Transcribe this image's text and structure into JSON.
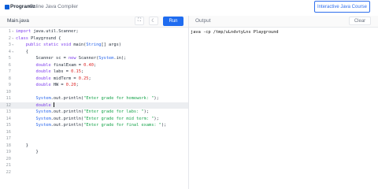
{
  "header": {
    "logo_text": "Programiz",
    "subtitle": "Online Java Compiler",
    "course_button": "Interactive Java Course"
  },
  "editor": {
    "file_tab": "Main.java",
    "run_label": "Run",
    "lines": [
      {
        "n": "1",
        "fold": "▾",
        "parts": [
          [
            "kw",
            "import "
          ],
          [
            "",
            "java.util.Scanner;"
          ]
        ]
      },
      {
        "n": "2",
        "fold": "▾",
        "parts": [
          [
            "kw",
            "class "
          ],
          [
            "",
            "Playground {"
          ]
        ]
      },
      {
        "n": "3",
        "fold": "▾",
        "parts": [
          [
            "",
            "    "
          ],
          [
            "kw",
            "public static void "
          ],
          [
            "",
            "main("
          ],
          [
            "ty",
            "String"
          ],
          [
            "",
            "[] args)"
          ]
        ]
      },
      {
        "n": "4",
        "fold": "▾",
        "parts": [
          [
            "",
            "    {"
          ]
        ]
      },
      {
        "n": "5",
        "fold": "",
        "parts": [
          [
            "",
            "        Scanner sc = "
          ],
          [
            "kw",
            "new "
          ],
          [
            "",
            "Scanner("
          ],
          [
            "ty",
            "System"
          ],
          [
            "",
            "."
          ],
          [
            "",
            "in);"
          ]
        ]
      },
      {
        "n": "6",
        "fold": "",
        "parts": [
          [
            "",
            "        "
          ],
          [
            "kw",
            "double "
          ],
          [
            "",
            "finalExam = "
          ],
          [
            "num",
            "0.40"
          ],
          [
            "",
            ";"
          ]
        ]
      },
      {
        "n": "7",
        "fold": "",
        "parts": [
          [
            "",
            "        "
          ],
          [
            "kw",
            "double "
          ],
          [
            "",
            "labs = "
          ],
          [
            "num",
            "0.15"
          ],
          [
            "",
            ";"
          ]
        ]
      },
      {
        "n": "8",
        "fold": "",
        "parts": [
          [
            "",
            "        "
          ],
          [
            "kw",
            "double "
          ],
          [
            "",
            "midTerm = "
          ],
          [
            "num",
            "0.25"
          ],
          [
            "",
            ";"
          ]
        ]
      },
      {
        "n": "9",
        "fold": "",
        "parts": [
          [
            "",
            "        "
          ],
          [
            "kw",
            "double "
          ],
          [
            "",
            "HW = "
          ],
          [
            "num",
            "0.20"
          ],
          [
            "",
            ";"
          ]
        ]
      },
      {
        "n": "10",
        "fold": "",
        "parts": [
          [
            "",
            ""
          ]
        ]
      },
      {
        "n": "11",
        "fold": "",
        "parts": [
          [
            "",
            "        "
          ],
          [
            "ty",
            "System"
          ],
          [
            "",
            ".out.println("
          ],
          [
            "str",
            "\"Enter grade for homework: \""
          ],
          [
            "",
            ");"
          ]
        ]
      },
      {
        "n": "12",
        "fold": "",
        "active": true,
        "parts": [
          [
            "",
            "        "
          ],
          [
            "kw",
            "double "
          ]
        ]
      },
      {
        "n": "13",
        "fold": "",
        "parts": [
          [
            "",
            "        "
          ],
          [
            "ty",
            "System"
          ],
          [
            "",
            ".out.println("
          ],
          [
            "str",
            "\"Enter grade for labs: \""
          ],
          [
            "",
            ");"
          ]
        ]
      },
      {
        "n": "14",
        "fold": "",
        "parts": [
          [
            "",
            "        "
          ],
          [
            "ty",
            "System"
          ],
          [
            "",
            ".out.println("
          ],
          [
            "str",
            "\"Enter grade for mid term: \""
          ],
          [
            "",
            ");"
          ]
        ]
      },
      {
        "n": "15",
        "fold": "",
        "parts": [
          [
            "",
            "        "
          ],
          [
            "ty",
            "System"
          ],
          [
            "",
            ".out.println("
          ],
          [
            "str",
            "\"Enter grade for final exams: \""
          ],
          [
            "",
            ");"
          ]
        ]
      },
      {
        "n": "16",
        "fold": "",
        "parts": [
          [
            "",
            ""
          ]
        ]
      },
      {
        "n": "17",
        "fold": "",
        "parts": [
          [
            "",
            ""
          ]
        ]
      },
      {
        "n": "18",
        "fold": "",
        "parts": [
          [
            "",
            "    }"
          ]
        ]
      },
      {
        "n": "19",
        "fold": "",
        "parts": [
          [
            "",
            "        }"
          ]
        ]
      },
      {
        "n": "20",
        "fold": "",
        "parts": [
          [
            "",
            ""
          ]
        ]
      },
      {
        "n": "21",
        "fold": "",
        "parts": [
          [
            "",
            ""
          ]
        ]
      },
      {
        "n": "22",
        "fold": "",
        "parts": [
          [
            "",
            ""
          ]
        ]
      }
    ]
  },
  "output": {
    "label": "Output",
    "clear_label": "Clear",
    "text": "java -cp /tmp/uLndvtyLns Playground"
  },
  "icons": {
    "fullscreen": "fullscreen-icon",
    "theme": "moon-icon"
  }
}
